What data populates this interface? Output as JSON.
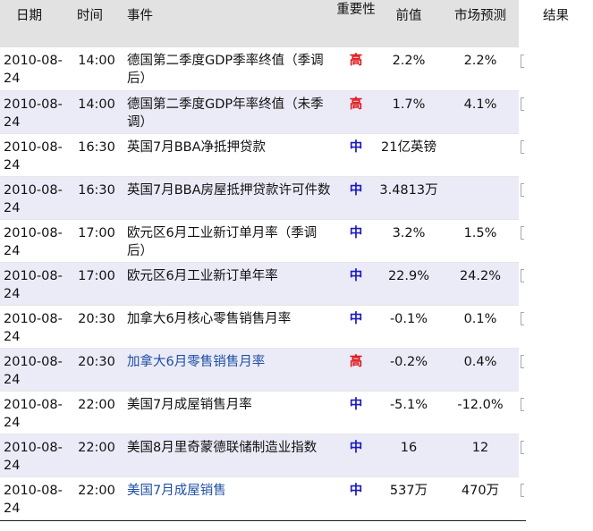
{
  "headers": {
    "date": "日期",
    "time": "时间",
    "event": "事件",
    "importance": "重要性",
    "previous": "前值",
    "forecast": "市场预测",
    "result": "结果"
  },
  "rows": [
    {
      "date": "2010-08-24",
      "time": "14:00",
      "event": "德国第二季度GDP季率终值（季调后）",
      "importance": "高",
      "level": "high",
      "previous": "2.2%",
      "forecast": "2.2%",
      "link": false
    },
    {
      "date": "2010-08-24",
      "time": "14:00",
      "event": "德国第二季度GDP年率终值（未季调）",
      "importance": "高",
      "level": "high",
      "previous": "1.7%",
      "forecast": "4.1%",
      "link": false
    },
    {
      "date": "2010-08-24",
      "time": "16:30",
      "event": "英国7月BBA净抵押贷款",
      "importance": "中",
      "level": "mid",
      "previous": "21亿英镑",
      "forecast": "",
      "link": false
    },
    {
      "date": "2010-08-24",
      "time": "16:30",
      "event": "英国7月BBA房屋抵押贷款许可件数",
      "importance": "中",
      "level": "mid",
      "previous": "3.4813万",
      "forecast": "",
      "link": false
    },
    {
      "date": "2010-08-24",
      "time": "17:00",
      "event": "欧元区6月工业新订单月率（季调后）",
      "importance": "中",
      "level": "mid",
      "previous": "3.2%",
      "forecast": "1.5%",
      "link": false
    },
    {
      "date": "2010-08-24",
      "time": "17:00",
      "event": "欧元区6月工业新订单年率",
      "importance": "中",
      "level": "mid",
      "previous": "22.9%",
      "forecast": "24.2%",
      "link": false
    },
    {
      "date": "2010-08-24",
      "time": "20:30",
      "event": "加拿大6月核心零售销售月率",
      "importance": "中",
      "level": "mid",
      "previous": "-0.1%",
      "forecast": "0.1%",
      "link": false
    },
    {
      "date": "2010-08-24",
      "time": "20:30",
      "event": "加拿大6月零售销售月率",
      "importance": "高",
      "level": "high",
      "previous": "-0.2%",
      "forecast": "0.4%",
      "link": true
    },
    {
      "date": "2010-08-24",
      "time": "22:00",
      "event": "美国7月成屋销售月率",
      "importance": "中",
      "level": "mid",
      "previous": "-5.1%",
      "forecast": "-12.0%",
      "link": false
    },
    {
      "date": "2010-08-24",
      "time": "22:00",
      "event": "美国8月里奇蒙德联储制造业指数",
      "importance": "中",
      "level": "mid",
      "previous": "16",
      "forecast": "12",
      "link": false
    },
    {
      "date": "2010-08-24",
      "time": "22:00",
      "event": "美国7月成屋销售",
      "importance": "中",
      "level": "mid",
      "previous": "537万",
      "forecast": "470万",
      "link": true
    }
  ]
}
